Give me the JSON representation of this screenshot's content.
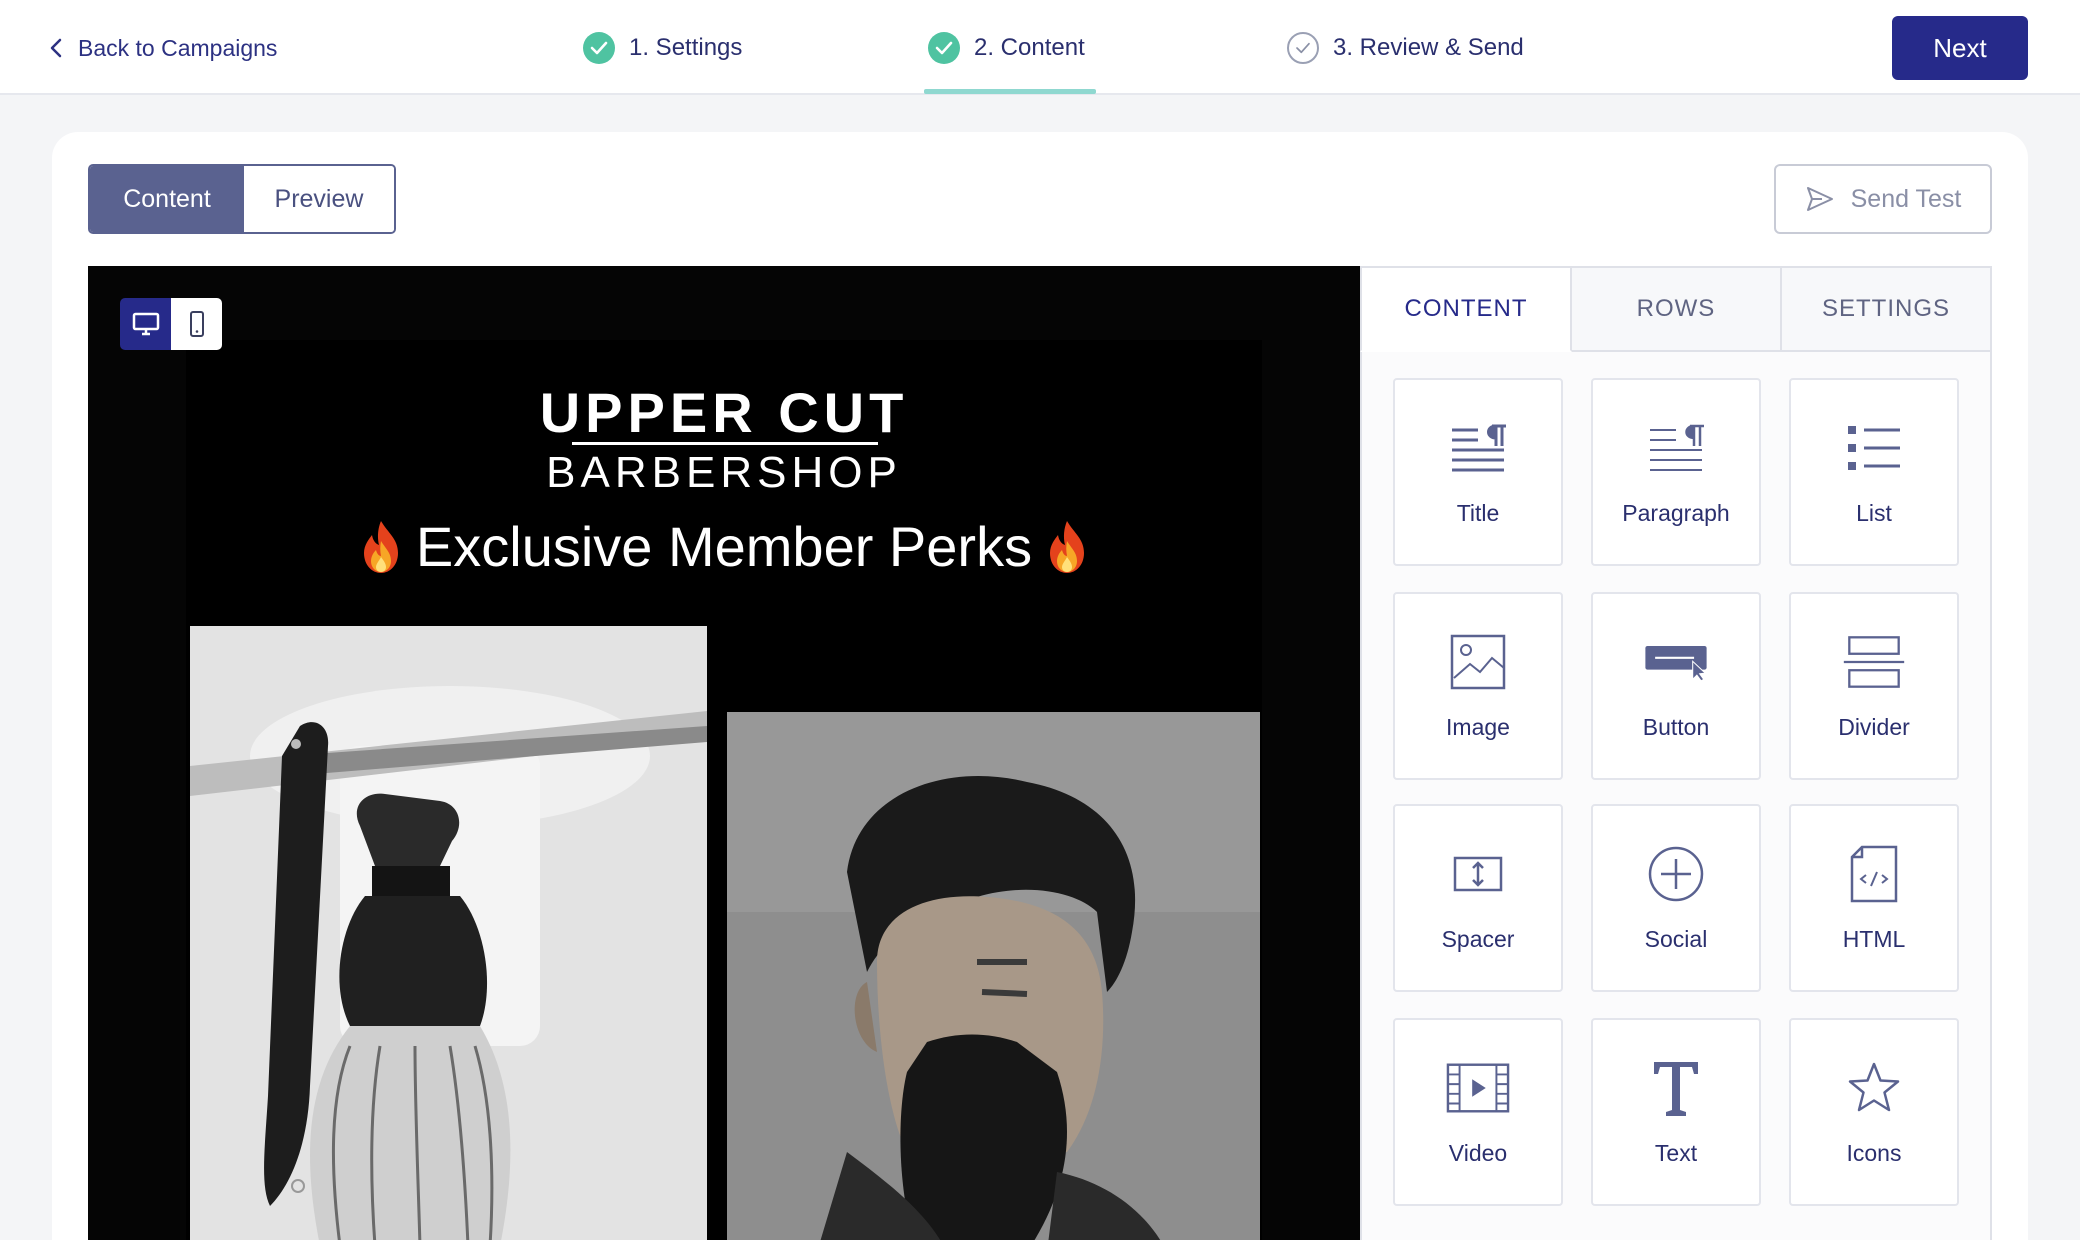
{
  "topbar": {
    "back_label": "Back to Campaigns",
    "steps": [
      {
        "label": "1. Settings",
        "status": "complete"
      },
      {
        "label": "2. Content",
        "status": "complete"
      },
      {
        "label": "3. Review & Send",
        "status": "pending"
      }
    ],
    "active_step": "2. Content",
    "next_label": "Next"
  },
  "toolbar": {
    "view_tabs": [
      "Content",
      "Preview"
    ],
    "active_view": "Content",
    "send_test_label": "Send Test"
  },
  "device_toggle": {
    "options": [
      "desktop-icon",
      "mobile-icon"
    ],
    "active": "desktop"
  },
  "email": {
    "logo_top": "UPPER CUT",
    "logo_bottom": "BARBERSHOP",
    "headline": "Exclusive Member Perks",
    "headline_emoji": "flame-icon",
    "images": [
      "razor-and-brush-photo",
      "bearded-man-photo"
    ]
  },
  "panel": {
    "tabs": [
      "CONTENT",
      "ROWS",
      "SETTINGS"
    ],
    "active_tab": "CONTENT",
    "blocks": [
      {
        "label": "Title",
        "icon": "title-icon"
      },
      {
        "label": "Paragraph",
        "icon": "paragraph-icon"
      },
      {
        "label": "List",
        "icon": "list-icon"
      },
      {
        "label": "Image",
        "icon": "image-icon"
      },
      {
        "label": "Button",
        "icon": "button-icon"
      },
      {
        "label": "Divider",
        "icon": "divider-icon"
      },
      {
        "label": "Spacer",
        "icon": "spacer-icon"
      },
      {
        "label": "Social",
        "icon": "social-icon"
      },
      {
        "label": "HTML",
        "icon": "html-icon"
      },
      {
        "label": "Video",
        "icon": "video-icon"
      },
      {
        "label": "Text",
        "icon": "text-icon"
      },
      {
        "label": "Icons",
        "icon": "star-icon"
      }
    ]
  },
  "colors": {
    "primary": "#262a8a",
    "step_complete": "#4fc3a1",
    "step_underline": "#8fd8d0",
    "segment_active": "#5a6290",
    "canvas_bg": "#050505"
  }
}
